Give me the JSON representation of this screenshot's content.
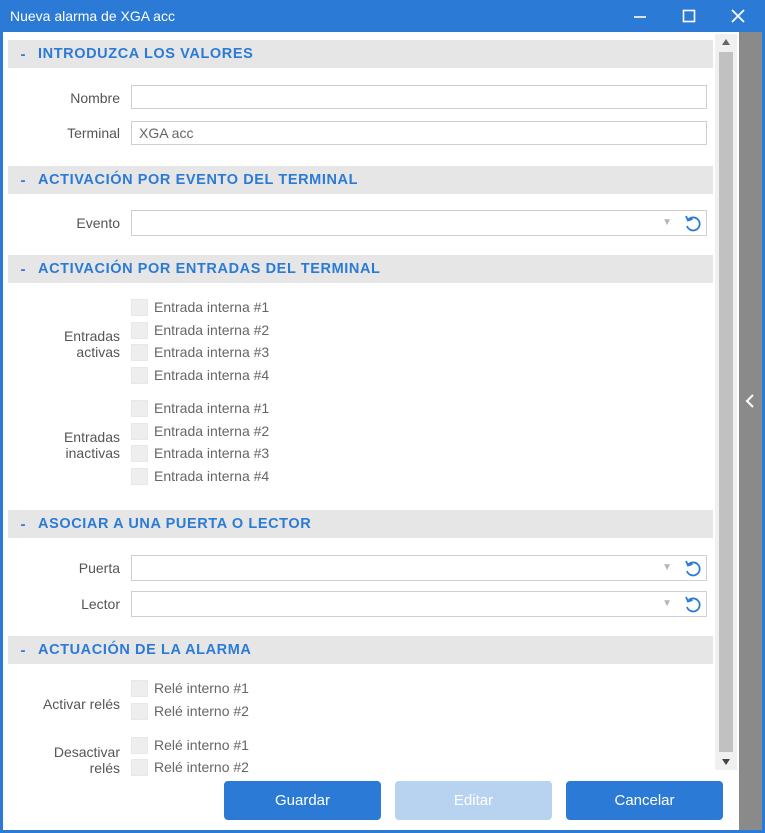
{
  "window": {
    "title": "Nueva alarma de XGA acc",
    "minimize_icon": "minimize-icon",
    "maximize_icon": "maximize-icon",
    "close_icon": "close-icon"
  },
  "colors": {
    "accent": "#2b7bd6",
    "section_bg": "#e6e6e6",
    "button_primary": "#2b7bd6",
    "button_disabled": "#b7d3ef"
  },
  "sections": {
    "values": {
      "toggle": "-",
      "title": "INTRODUZCA LOS VALORES",
      "nombre_label": "Nombre",
      "nombre_value": "",
      "terminal_label": "Terminal",
      "terminal_value": "XGA acc"
    },
    "evento": {
      "toggle": "-",
      "title": "ACTIVACIÓN POR EVENTO DEL TERMINAL",
      "evento_label": "Evento",
      "evento_value": ""
    },
    "entradas": {
      "toggle": "-",
      "title": "ACTIVACIÓN POR ENTRADAS DEL TERMINAL",
      "activas_label_1": "Entradas",
      "activas_label_2": "activas",
      "activas": [
        {
          "label": "Entrada interna #1",
          "checked": false
        },
        {
          "label": "Entrada interna #2",
          "checked": false
        },
        {
          "label": "Entrada interna #3",
          "checked": false
        },
        {
          "label": "Entrada interna #4",
          "checked": false
        }
      ],
      "inactivas_label_1": "Entradas",
      "inactivas_label_2": "inactivas",
      "inactivas": [
        {
          "label": "Entrada interna #1",
          "checked": false
        },
        {
          "label": "Entrada interna #2",
          "checked": false
        },
        {
          "label": "Entrada interna #3",
          "checked": false
        },
        {
          "label": "Entrada interna #4",
          "checked": false
        }
      ]
    },
    "puerta": {
      "toggle": "-",
      "title": "ASOCIAR A UNA PUERTA O LECTOR",
      "puerta_label": "Puerta",
      "puerta_value": "",
      "lector_label": "Lector",
      "lector_value": ""
    },
    "actuacion": {
      "toggle": "-",
      "title": "ACTUACIÓN DE LA ALARMA",
      "activar_label": "Activar relés",
      "activar": [
        {
          "label": "Relé interno #1",
          "checked": false
        },
        {
          "label": "Relé interno #2",
          "checked": false
        }
      ],
      "desactivar_label_1": "Desactivar",
      "desactivar_label_2": "relés",
      "desactivar": [
        {
          "label": "Relé interno #1",
          "checked": false
        },
        {
          "label": "Relé interno #2",
          "checked": false
        }
      ]
    }
  },
  "footer": {
    "save_label": "Guardar",
    "edit_label": "Editar",
    "cancel_label": "Cancelar"
  }
}
